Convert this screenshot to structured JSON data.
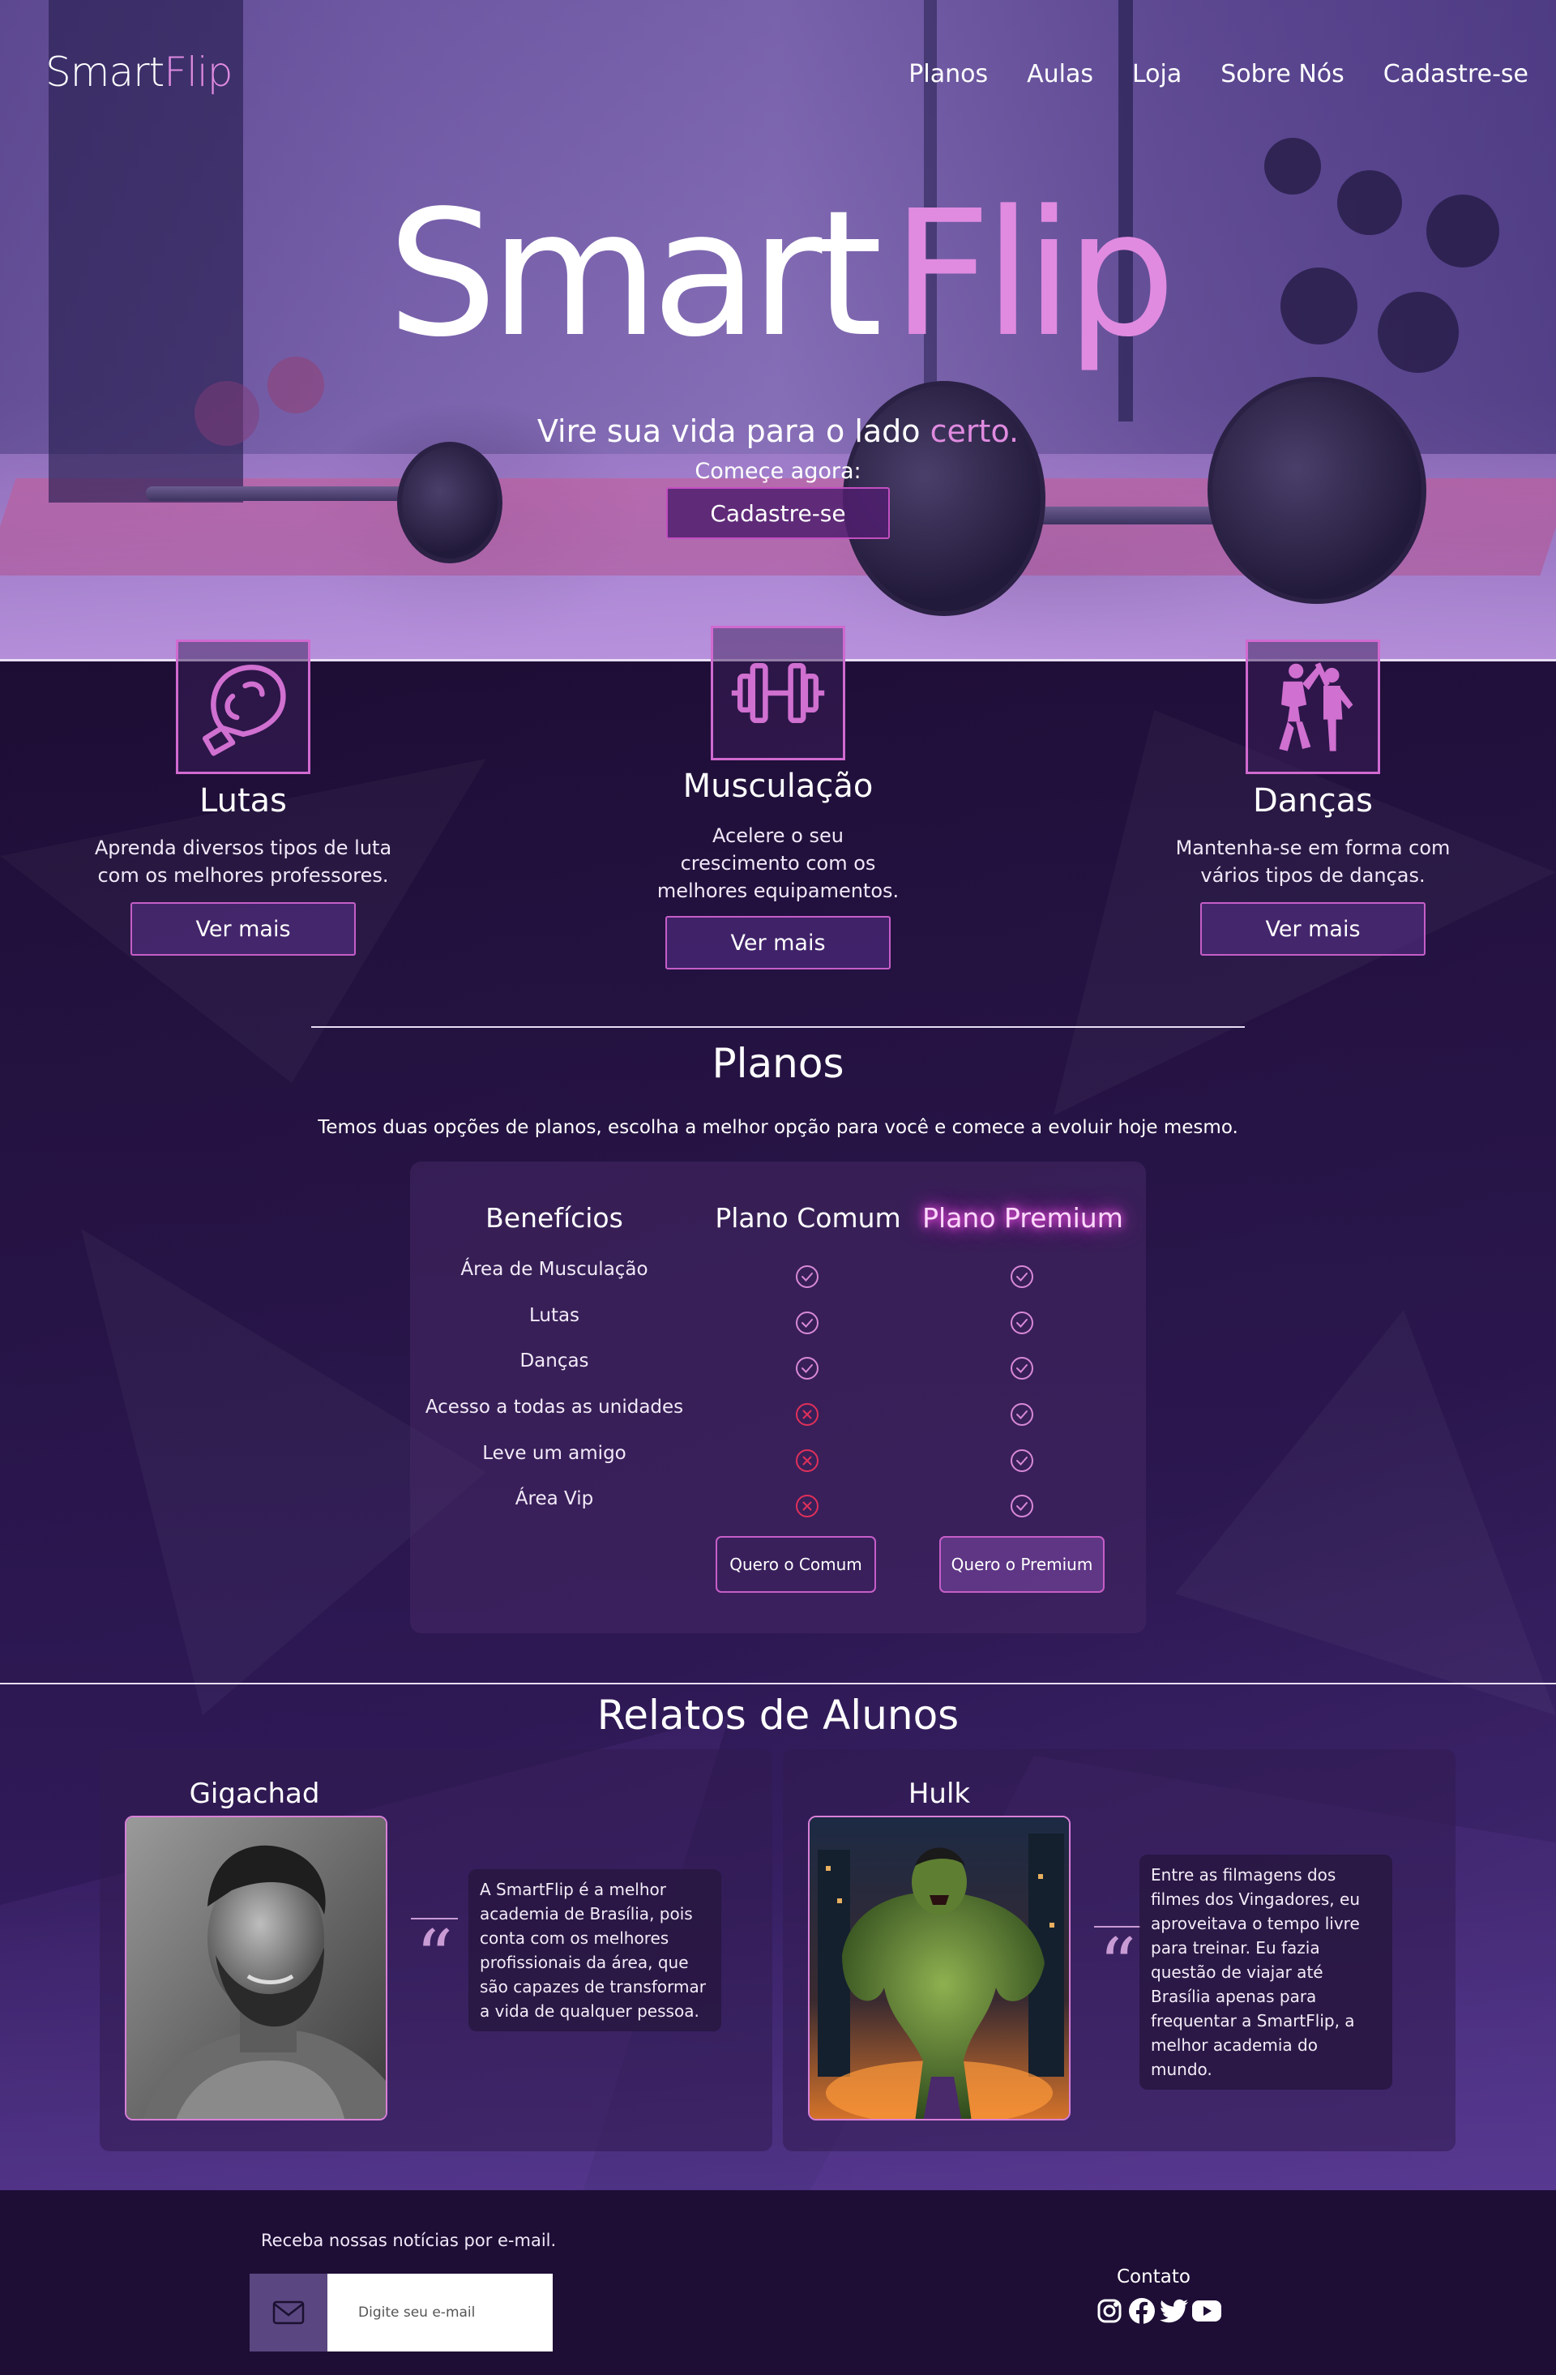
{
  "nav": {
    "logo_smart": "Smart",
    "logo_flip": "Flip",
    "links": [
      "Planos",
      "Aulas",
      "Loja",
      "Sobre Nós",
      "Cadastre-se"
    ]
  },
  "hero": {
    "title_smart": "Smart",
    "title_flip": "Flip",
    "subtitle": "Vire sua vida para o lado",
    "subtitle_accent": "certo.",
    "start_text": "Começe agora:",
    "cta": "Cadastre-se"
  },
  "features": [
    {
      "icon": "boxing-glove-icon",
      "title": "Lutas",
      "description": "Aprenda diversos tipos de luta com os melhores professores.",
      "button": "Ver mais"
    },
    {
      "icon": "dumbbell-icon",
      "title": "Musculação",
      "description": "Acelere o seu crescimento com os melhores equipamentos.",
      "button": "Ver mais"
    },
    {
      "icon": "dancers-icon",
      "title": "Danças",
      "description": "Mantenha-se em forma com vários tipos de danças.",
      "button": "Ver mais"
    }
  ],
  "plans": {
    "title": "Planos",
    "description": "Temos duas opções de planos, escolha a melhor opção para você e comece a evoluir hoje mesmo.",
    "headers": {
      "benefits": "Benefícios",
      "common": "Plano Comum",
      "premium": "Plano Premium"
    },
    "rows": [
      {
        "label": "Área de Musculação",
        "common": true,
        "premium": true
      },
      {
        "label": "Lutas",
        "common": true,
        "premium": true
      },
      {
        "label": "Danças",
        "common": true,
        "premium": true
      },
      {
        "label": "Acesso a todas as unidades",
        "common": false,
        "premium": true
      },
      {
        "label": "Leve um amigo",
        "common": false,
        "premium": true
      },
      {
        "label": "Área Vip",
        "common": false,
        "premium": true
      }
    ],
    "btn_common": "Quero o Comum",
    "btn_premium": "Quero o Premium"
  },
  "reviews": {
    "title": "Relatos de Alunos",
    "items": [
      {
        "name": "Gigachad",
        "text": "A SmartFlip é a melhor academia de Brasília, pois conta com os melhores profissionais da área, que são capazes de transformar a vida de qualquer pessoa."
      },
      {
        "name": "Hulk",
        "text": "Entre as filmagens dos filmes dos Vingadores, eu aproveitava o tempo livre para treinar. Eu fazia questão de viajar até Brasília apenas para frequentar a SmartFlip, a melhor academia do mundo."
      }
    ]
  },
  "footer": {
    "newsletter": "Receba nossas notícias por e-mail.",
    "email_placeholder": "Digite seu e-mail",
    "contact": "Contato",
    "socials": [
      "instagram-icon",
      "facebook-icon",
      "twitter-icon",
      "youtube-icon"
    ]
  },
  "colors": {
    "accent": "#e08be0",
    "border_accent": "#c65ec8",
    "error": "#e0305a"
  }
}
